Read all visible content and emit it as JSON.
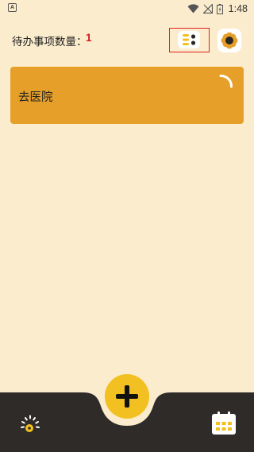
{
  "status_bar": {
    "app_icon_letter": "A",
    "time": "1:48"
  },
  "header": {
    "pending_label": "待办事项数量：",
    "pending_count": "1"
  },
  "tasks": [
    {
      "title": "去医院"
    }
  ],
  "colors": {
    "background": "#fbeccd",
    "task_card": "#e6a02a",
    "accent_yellow": "#f2c021",
    "nav_dark": "#2e2b28",
    "count_red": "#d11c1c",
    "highlight_border": "#e02020"
  },
  "icons": {
    "view_toggle": "list-view-icon",
    "settings": "flower-settings-icon",
    "add": "plus-icon",
    "stats": "gauge-icon",
    "calendar": "calendar-icon",
    "task_status": "progress-arc-icon"
  }
}
